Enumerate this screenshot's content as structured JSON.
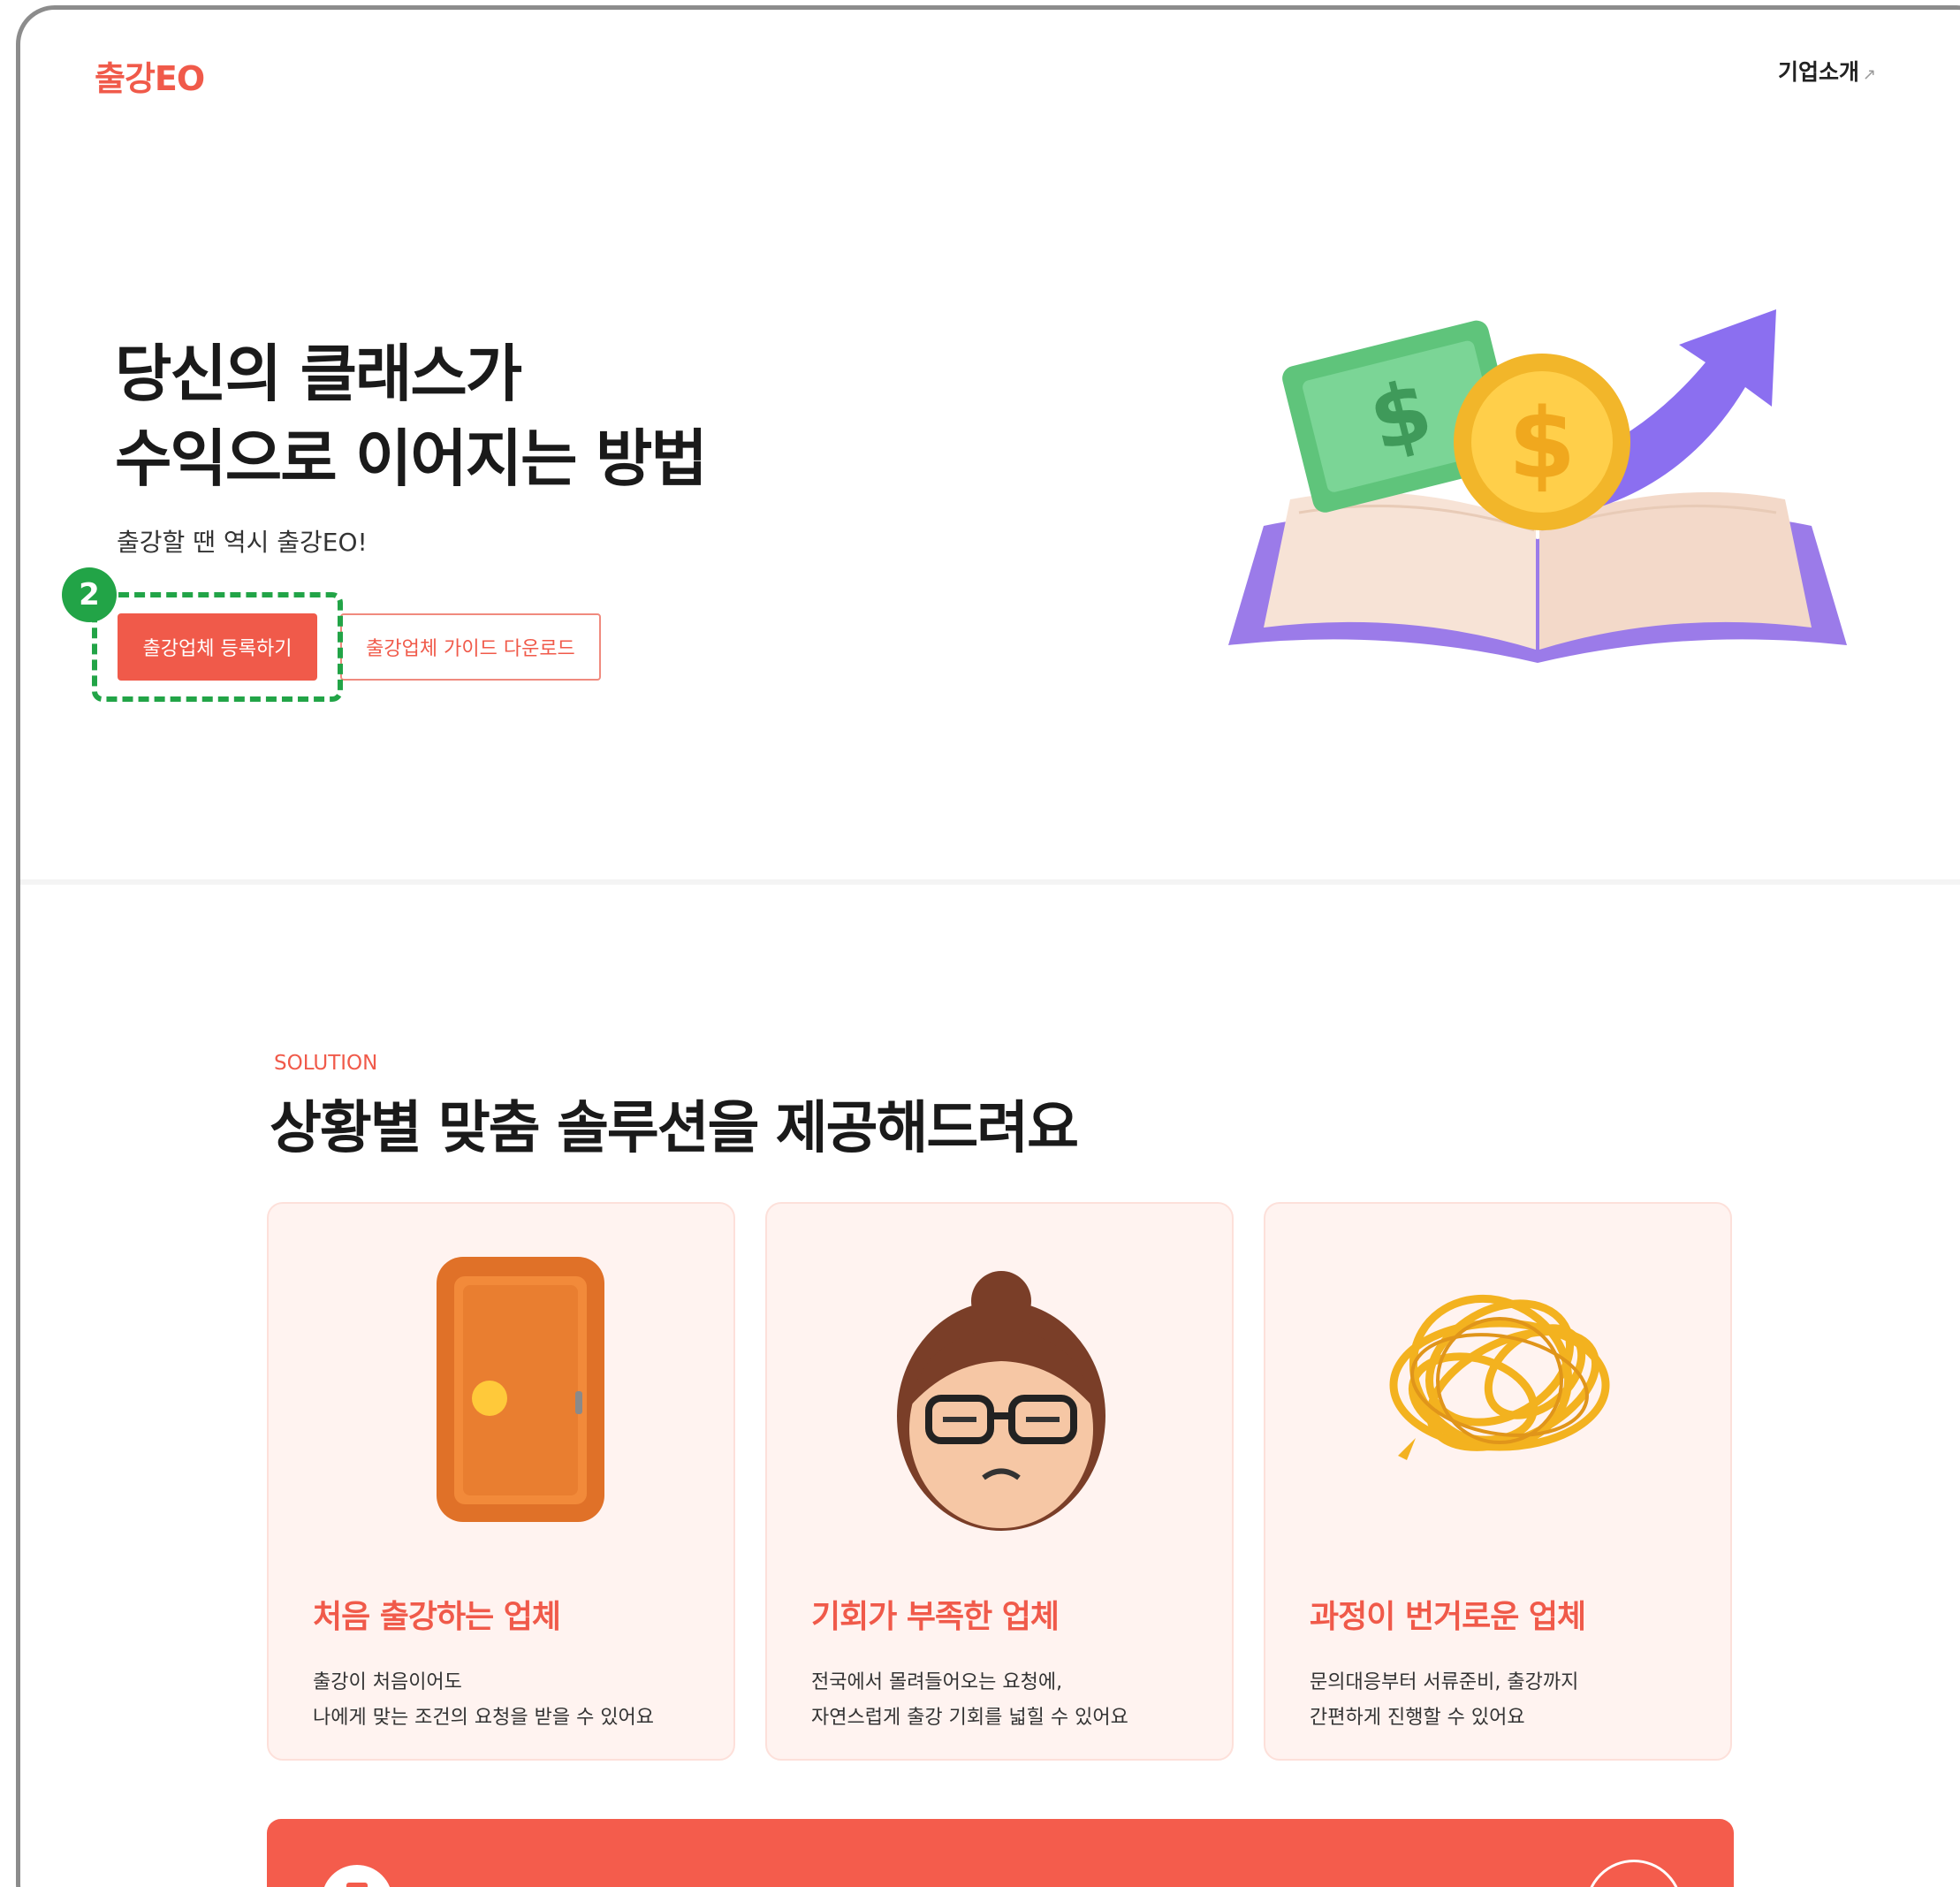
{
  "header": {
    "logo": "출강EO",
    "nav_link": "기업소개",
    "nav_link_icon": "external-arrow-icon"
  },
  "hero": {
    "title_line1": "당신의 클래스가",
    "title_line2": "수익으로 이어지는 방법",
    "subtitle": "출강할 땐 역시 출강EO!",
    "primary_button": "출강업체 등록하기",
    "secondary_button": "출강업체 가이드 다운로드",
    "illustration": "money-book-growth-illustration"
  },
  "annotation": {
    "step_number": "2",
    "color": "#22a447"
  },
  "solution": {
    "eyebrow": "SOLUTION",
    "title": "상황별 맞춤 솔루션을 제공해드려요",
    "cards": [
      {
        "icon": "door-icon",
        "title": "처음 출강하는 업체",
        "desc_line1": "출강이 처음이어도",
        "desc_line2": "나에게 맞는 조건의 요청을 받을 수 있어요"
      },
      {
        "icon": "worried-face-icon",
        "title": "기회가 부족한 업체",
        "desc_line1": "전국에서 몰려들어오는 요청에,",
        "desc_line2": "자연스럽게 출강 기회를 넓힐 수 있어요"
      },
      {
        "icon": "tangled-string-icon",
        "title": "과정이 번거로운 업체",
        "desc_line1": "문의대응부터 서류준비, 출강까지",
        "desc_line2": "간편하게 진행할 수 있어요"
      }
    ]
  },
  "colors": {
    "brand": "#f05a4a",
    "card_bg": "#fff3f0"
  }
}
